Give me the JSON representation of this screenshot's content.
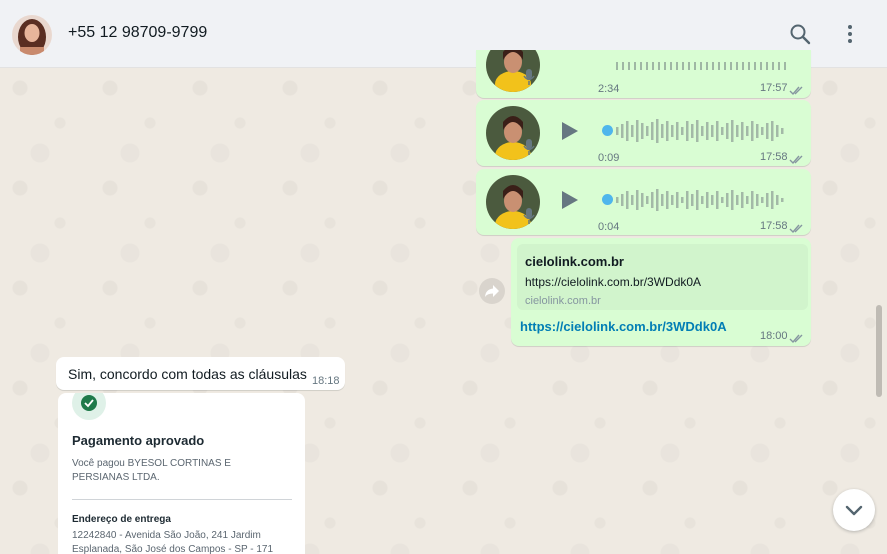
{
  "header": {
    "contact_name": "+55 12 98709-9799",
    "search_icon": "search-icon",
    "menu_icon": "more-vertical-icon"
  },
  "voice_messages": [
    {
      "duration": "2:34",
      "time": "17:57"
    },
    {
      "duration": "0:09",
      "time": "17:58"
    },
    {
      "duration": "0:04",
      "time": "17:58"
    }
  ],
  "link_message": {
    "preview_title": "cielolink.com.br",
    "preview_description": "https://cielolink.com.br/3WDdk0A",
    "preview_domain": "cielolink.com.br",
    "link_text": "https://cielolink.com.br/3WDdk0A",
    "time": "18:00"
  },
  "incoming_message": {
    "text": "Sim, concordo com todas as cláusulas",
    "time": "18:18"
  },
  "receipt": {
    "title": "Pagamento aprovado",
    "text": "Você pagou BYESOL CORTINAS E PERSIANAS LTDA.",
    "address_heading": "Endereço de entrega",
    "address_line": "12242840 - Avenida São João, 241 Jardim Esplanada, São José dos Campos - SP - 171"
  },
  "colors": {
    "outgoing_bubble": "#d9fdd3",
    "incoming_bubble": "#ffffff",
    "link": "#027eb5",
    "read_ticks": "#8696a0",
    "wave_dot": "#4fb6ec"
  }
}
